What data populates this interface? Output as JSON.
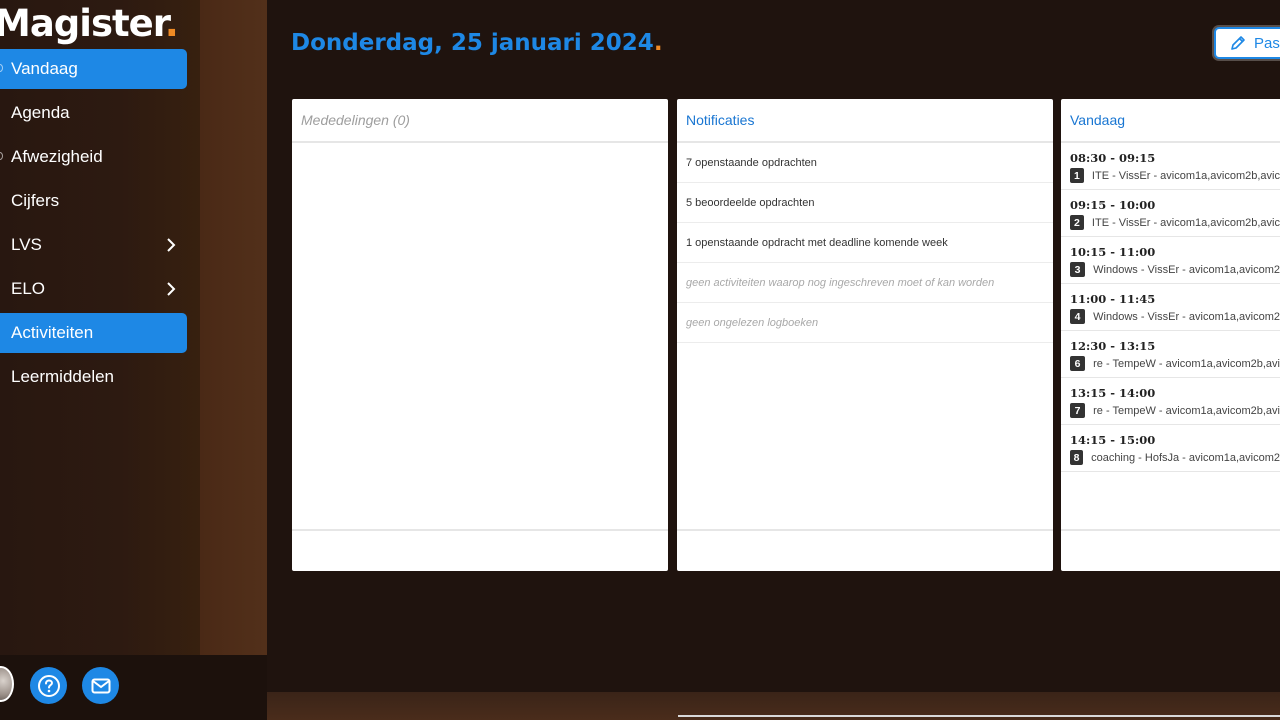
{
  "app": {
    "logo_text": "Magister",
    "logo_dot": "."
  },
  "sidebar": {
    "items": [
      {
        "label": "Vandaag",
        "active": true,
        "chevron": false
      },
      {
        "label": "Agenda",
        "active": false,
        "chevron": false
      },
      {
        "label": "Afwezigheid",
        "active": false,
        "chevron": false
      },
      {
        "label": "Cijfers",
        "active": false,
        "chevron": false
      },
      {
        "label": "LVS",
        "active": false,
        "chevron": true
      },
      {
        "label": "ELO",
        "active": false,
        "chevron": true
      },
      {
        "label": "Activiteiten",
        "active": true,
        "chevron": false
      },
      {
        "label": "Leermiddelen",
        "active": false,
        "chevron": false
      }
    ]
  },
  "header": {
    "title": "Donderdag, 25 januari 2024",
    "title_dot": ".",
    "edit_label": "Pas"
  },
  "widgets": {
    "announcements": {
      "title": "Mededelingen (0)"
    },
    "notifications": {
      "title": "Notificaties",
      "items": [
        {
          "text": "7 openstaande opdrachten",
          "muted": false
        },
        {
          "text": "5 beoordeelde opdrachten",
          "muted": false
        },
        {
          "text": "1 openstaande opdracht met deadline komende week",
          "muted": false
        },
        {
          "text": "geen activiteiten waarop nog ingeschreven moet of kan worden",
          "muted": true
        },
        {
          "text": "geen ongelezen logboeken",
          "muted": true
        }
      ]
    },
    "today": {
      "title": "Vandaag",
      "lessons": [
        {
          "time": "08:30 - 09:15",
          "hour": "1",
          "desc": "ITE - VissEr - avicom1a,avicom2b,avic"
        },
        {
          "time": "09:15 - 10:00",
          "hour": "2",
          "desc": "ITE - VissEr - avicom1a,avicom2b,avic"
        },
        {
          "time": "10:15 - 11:00",
          "hour": "3",
          "desc": "Windows - VissEr - avicom1a,avicom2"
        },
        {
          "time": "11:00 - 11:45",
          "hour": "4",
          "desc": "Windows - VissEr - avicom1a,avicom2"
        },
        {
          "time": "12:30 - 13:15",
          "hour": "6",
          "desc": "re - TempeW - avicom1a,avicom2b,avi"
        },
        {
          "time": "13:15 - 14:00",
          "hour": "7",
          "desc": "re - TempeW - avicom1a,avicom2b,avi"
        },
        {
          "time": "14:15 - 15:00",
          "hour": "8",
          "desc": "coaching - HofsJa - avicom1a,avicom2"
        }
      ]
    }
  },
  "colors": {
    "accent": "#1e88e5",
    "brand_dot": "#f08a24",
    "background": "#1f130e"
  }
}
